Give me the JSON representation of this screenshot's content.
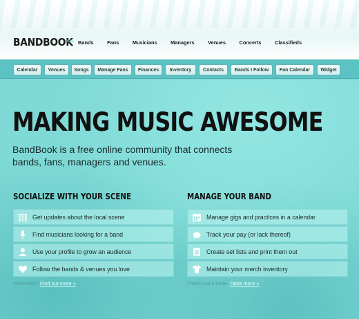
{
  "brand": {
    "name": "BANDBOOK",
    "tag": "beta"
  },
  "nav": [
    "Bands",
    "Fans",
    "Musicians",
    "Managers",
    "Venues",
    "Concerts",
    "Classifieds"
  ],
  "toolbar": [
    "Calendar",
    "Venues",
    "Songs",
    "Manage Fans",
    "Finances",
    "Inventory",
    "Contacts",
    "Bands I Follow",
    "Fan Calendar",
    "Widget"
  ],
  "hero": {
    "headline": "MAKING MUSIC AWESOME",
    "intro": "BandBook is a free online community that connects bands, fans, managers and venues."
  },
  "left": {
    "title": "SOCIALIZE WITH YOUR SCENE",
    "items": [
      {
        "icon": "calendar-grid-icon",
        "text": "Get updates about the local scene"
      },
      {
        "icon": "microphone-icon",
        "text": "Find musicians looking for a band"
      },
      {
        "icon": "user-icon",
        "text": "Use your profile to grow an audience"
      },
      {
        "icon": "heart-icon",
        "text": "Follow the bands & venues you love"
      }
    ],
    "more_text": "Interested?",
    "more_link": "Find out more »"
  },
  "right": {
    "title": "MANAGE YOUR BAND",
    "items": [
      {
        "icon": "calendar-icon",
        "text": "Manage gigs and practices in a calendar"
      },
      {
        "icon": "piggy-bank-icon",
        "text": "Track your pay (or lack thereof)"
      },
      {
        "icon": "list-icon",
        "text": "Create set lists and print them out"
      },
      {
        "icon": "tshirt-icon",
        "text": "Maintain your merch inventory"
      }
    ],
    "more_text": "That's just a taste.",
    "more_link": "Taste more »"
  },
  "colors": {
    "accent": "#5cc3c4",
    "background": "#7fd9d6",
    "text": "#111111"
  }
}
